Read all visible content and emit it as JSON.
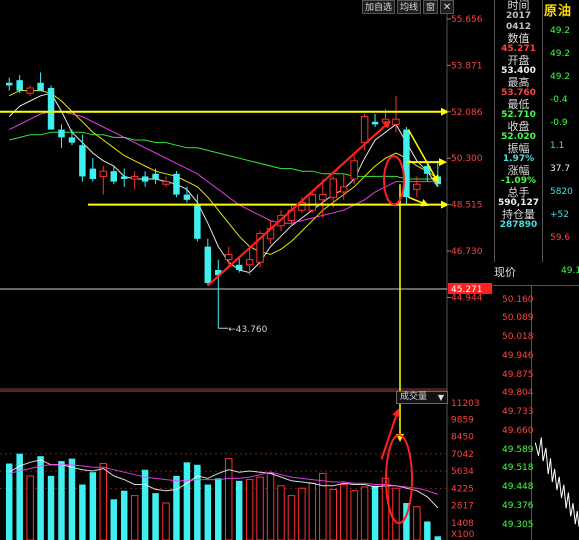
{
  "toolbar": {
    "add_label": "加自选",
    "ma_label": "均线",
    "window_label": "窗",
    "close_label": "✕"
  },
  "price_axis": {
    "ticks": [
      "55.656",
      "53.871",
      "52.086",
      "50.300",
      "48.515",
      "46.730",
      "44.944"
    ],
    "current_marker": "45.271"
  },
  "volume_axis": {
    "menu_label": "成交量",
    "ticks": [
      "11203",
      "9859",
      "8450",
      "7042",
      "5634",
      "4225",
      "2817",
      "1408"
    ],
    "multiplier": "X100"
  },
  "low_annotation": "43.760",
  "info_panel": {
    "time_label": "时间",
    "year": "2017",
    "date": "0412",
    "value_label": "数值",
    "value": "45.271",
    "open_label": "开盘",
    "open": "53.400",
    "high_label": "最高",
    "high": "53.760",
    "low_label": "最低",
    "low": "52.710",
    "close_label": "收盘",
    "close": "52.020",
    "amplitude_label": "振幅",
    "amplitude": "1.97%",
    "change_label": "涨幅",
    "change": "-1.09%",
    "volume_label": "总手",
    "volume": "590,127",
    "oi_label": "持仓量",
    "oi": "287890"
  },
  "side_panel": {
    "title": "原油",
    "rows": [
      {
        "text": "49.2",
        "color": "#40ff40"
      },
      {
        "text": "49.2",
        "color": "#40ff40"
      },
      {
        "text": "49.2",
        "color": "#40ff40"
      },
      {
        "text": "-0.4",
        "color": "#40ff40"
      },
      {
        "text": "-0.9",
        "color": "#40ff40"
      },
      {
        "text": "1.1",
        "color": "#40e0e0"
      },
      {
        "text": "37.7",
        "color": "#f0f0f0"
      },
      {
        "text": "5820",
        "color": "#40e0e0"
      },
      {
        "text": "+52",
        "color": "#40e0e0"
      },
      {
        "text": "59.6",
        "color": "#ff4040"
      }
    ]
  },
  "realtime": {
    "title": "现价",
    "value": "49.1",
    "ticks": [
      "50.160",
      "50.089",
      "50.018",
      "49.946",
      "49.875",
      "49.804",
      "49.733",
      "49.660",
      "49.589",
      "49.518",
      "49.448",
      "49.376",
      "49.305"
    ]
  },
  "colors": {
    "up": "#ff3030",
    "down": "#40f0f0",
    "ma5": "#ffffff",
    "ma10": "#ffff00",
    "ma20": "#ff44ff",
    "ma60": "#40ff40",
    "annotation": "#ffff00",
    "highlight": "#ff2020"
  },
  "chart_data": {
    "type": "candlestick",
    "ylim": [
      43.5,
      56.0
    ],
    "candles": [
      {
        "o": 53.2,
        "h": 53.4,
        "l": 52.9,
        "c": 53.1
      },
      {
        "o": 53.3,
        "h": 53.5,
        "l": 52.8,
        "c": 52.9
      },
      {
        "o": 52.8,
        "h": 53.1,
        "l": 52.7,
        "c": 53.0
      },
      {
        "o": 53.2,
        "h": 53.6,
        "l": 52.9,
        "c": 52.9
      },
      {
        "o": 53.0,
        "h": 53.1,
        "l": 51.4,
        "c": 51.4
      },
      {
        "o": 51.4,
        "h": 51.6,
        "l": 50.7,
        "c": 51.1
      },
      {
        "o": 51.1,
        "h": 51.4,
        "l": 50.8,
        "c": 50.9
      },
      {
        "o": 50.8,
        "h": 51.2,
        "l": 49.4,
        "c": 49.6
      },
      {
        "o": 49.9,
        "h": 50.3,
        "l": 49.4,
        "c": 49.5
      },
      {
        "o": 49.6,
        "h": 50.0,
        "l": 48.9,
        "c": 49.8
      },
      {
        "o": 49.8,
        "h": 50.0,
        "l": 49.3,
        "c": 49.4
      },
      {
        "o": 49.6,
        "h": 49.9,
        "l": 49.2,
        "c": 49.5
      },
      {
        "o": 49.5,
        "h": 49.8,
        "l": 49.1,
        "c": 49.6
      },
      {
        "o": 49.6,
        "h": 49.8,
        "l": 49.2,
        "c": 49.4
      },
      {
        "o": 49.7,
        "h": 49.9,
        "l": 49.3,
        "c": 49.5
      },
      {
        "o": 49.3,
        "h": 49.6,
        "l": 49.2,
        "c": 49.4
      },
      {
        "o": 49.7,
        "h": 49.8,
        "l": 48.8,
        "c": 48.9
      },
      {
        "o": 48.9,
        "h": 49.2,
        "l": 48.6,
        "c": 48.7
      },
      {
        "o": 48.5,
        "h": 48.9,
        "l": 47.1,
        "c": 47.2
      },
      {
        "o": 46.9,
        "h": 47.2,
        "l": 45.4,
        "c": 45.5
      },
      {
        "o": 46.0,
        "h": 46.4,
        "l": 43.76,
        "c": 45.8
      },
      {
        "o": 46.4,
        "h": 46.9,
        "l": 46.2,
        "c": 46.6
      },
      {
        "o": 46.2,
        "h": 46.5,
        "l": 45.9,
        "c": 46.0
      },
      {
        "o": 46.2,
        "h": 46.9,
        "l": 45.8,
        "c": 46.4
      },
      {
        "o": 46.3,
        "h": 47.5,
        "l": 46.1,
        "c": 47.4
      },
      {
        "o": 47.2,
        "h": 47.9,
        "l": 47.0,
        "c": 47.6
      },
      {
        "o": 47.7,
        "h": 48.3,
        "l": 47.5,
        "c": 48.1
      },
      {
        "o": 47.9,
        "h": 48.5,
        "l": 47.7,
        "c": 48.3
      },
      {
        "o": 48.3,
        "h": 48.8,
        "l": 48.2,
        "c": 48.6
      },
      {
        "o": 48.3,
        "h": 49.0,
        "l": 48.2,
        "c": 48.9
      },
      {
        "o": 48.7,
        "h": 49.5,
        "l": 48.0,
        "c": 48.9
      },
      {
        "o": 48.8,
        "h": 49.6,
        "l": 48.4,
        "c": 49.5
      },
      {
        "o": 49.0,
        "h": 49.7,
        "l": 48.7,
        "c": 49.2
      },
      {
        "o": 49.5,
        "h": 50.4,
        "l": 49.3,
        "c": 50.2
      },
      {
        "o": 50.9,
        "h": 52.0,
        "l": 50.6,
        "c": 51.9
      },
      {
        "o": 51.7,
        "h": 52.0,
        "l": 51.5,
        "c": 51.6
      },
      {
        "o": 51.7,
        "h": 52.2,
        "l": 51.5,
        "c": 51.8
      },
      {
        "o": 51.6,
        "h": 52.7,
        "l": 51.3,
        "c": 51.8
      },
      {
        "o": 51.4,
        "h": 51.5,
        "l": 48.5,
        "c": 48.8
      },
      {
        "o": 49.1,
        "h": 49.6,
        "l": 48.8,
        "c": 49.3
      },
      {
        "o": 50.0,
        "h": 50.2,
        "l": 49.4,
        "c": 49.7
      },
      {
        "o": 49.6,
        "h": 50.2,
        "l": 49.2,
        "c": 49.3
      }
    ],
    "volumes": [
      62,
      70,
      52,
      68,
      52,
      64,
      66,
      45,
      55,
      62,
      33,
      40,
      36,
      57,
      38,
      30,
      52,
      63,
      61,
      45,
      50,
      66,
      48,
      49,
      51,
      54,
      44,
      36,
      42,
      46,
      54,
      41,
      45,
      40,
      43,
      44,
      50,
      42,
      30,
      27,
      15,
      3
    ],
    "volume_ylim": [
      0,
      11203
    ],
    "ma_lines": [
      {
        "name": "MA5",
        "color": "#ffffff",
        "points": [
          51.9,
          52.3,
          52.5,
          52.7,
          52.8,
          52.1,
          51.3,
          50.9,
          50.5,
          50.2,
          50.0,
          49.6,
          49.5,
          49.5,
          49.5,
          49.4,
          49.3,
          49.1,
          48.6,
          47.8,
          46.9,
          46.3,
          46.0,
          45.9,
          46.3,
          46.9,
          47.3,
          47.7,
          48.0,
          48.3,
          48.6,
          48.9,
          49.1,
          49.5,
          50.3,
          51.0,
          51.3,
          51.6,
          50.9,
          50.2,
          49.8,
          49.2
        ]
      },
      {
        "name": "MA10",
        "color": "#ffff00",
        "points": [
          52.7,
          52.9,
          52.9,
          52.9,
          52.8,
          52.5,
          52.1,
          51.7,
          51.3,
          51.0,
          50.7,
          50.4,
          50.2,
          50.0,
          49.8,
          49.7,
          49.6,
          49.4,
          49.2,
          48.8,
          48.3,
          47.8,
          47.3,
          46.9,
          46.7,
          46.6,
          46.8,
          47.1,
          47.5,
          47.9,
          48.3,
          48.6,
          48.9,
          49.2,
          49.6,
          50.0,
          50.3,
          50.5,
          50.3,
          50.0,
          49.8,
          49.5
        ]
      },
      {
        "name": "MA20",
        "color": "#ff44ff",
        "points": [
          51.4,
          51.6,
          51.8,
          52.0,
          52.1,
          52.1,
          52.0,
          51.9,
          51.7,
          51.5,
          51.3,
          51.1,
          50.9,
          50.7,
          50.5,
          50.3,
          50.1,
          49.9,
          49.7,
          49.4,
          49.1,
          48.8,
          48.5,
          48.3,
          48.1,
          47.9,
          47.8,
          47.8,
          47.9,
          48.0,
          48.1,
          48.2,
          48.3,
          48.5,
          48.7,
          49.0,
          49.2,
          49.4,
          49.4,
          49.4,
          49.4,
          49.4
        ]
      },
      {
        "name": "MA60",
        "color": "#40ff40",
        "points": [
          51.0,
          51.1,
          51.2,
          51.2,
          51.3,
          51.3,
          51.3,
          51.3,
          51.2,
          51.2,
          51.1,
          51.1,
          51.0,
          51.0,
          50.9,
          50.9,
          50.8,
          50.7,
          50.7,
          50.6,
          50.5,
          50.4,
          50.3,
          50.2,
          50.1,
          50.0,
          49.9,
          49.9,
          49.8,
          49.8,
          49.7,
          49.7,
          49.7,
          49.6,
          49.6,
          49.6,
          49.6,
          49.6,
          49.5,
          49.5,
          49.5,
          49.5
        ]
      }
    ],
    "volume_ma": [
      {
        "name": "VMA5",
        "color": "#ffffff",
        "points": [
          55,
          60,
          63,
          65,
          61,
          61,
          59,
          57,
          56,
          58,
          52,
          49,
          45,
          45,
          41,
          40,
          41,
          46,
          52,
          50,
          54,
          57,
          55,
          56,
          55,
          54,
          51,
          48,
          47,
          46,
          44,
          44,
          46,
          45,
          45,
          43,
          44,
          44,
          42,
          40,
          35,
          26
        ]
      },
      {
        "name": "VMA10",
        "color": "#ff44ff",
        "points": [
          54,
          56,
          58,
          60,
          61,
          61,
          61,
          60,
          59,
          59,
          57,
          55,
          53,
          51,
          50,
          49,
          48,
          48,
          49,
          49,
          49,
          50,
          50,
          51,
          53,
          55,
          53,
          51,
          50,
          49,
          48,
          47,
          47,
          46,
          46,
          45,
          45,
          44,
          43,
          42,
          40,
          37
        ]
      }
    ],
    "volume_gridlines": [
      7042,
      5634,
      4225
    ],
    "horizontal_levels": [
      52.086,
      48.515
    ],
    "current_price_line": 45.271
  },
  "realtime_chart": {
    "ylim": [
      49.25,
      50.2
    ],
    "points": [
      [
        0.05,
        49.62
      ],
      [
        0.12,
        49.57
      ],
      [
        0.18,
        49.64
      ],
      [
        0.22,
        49.55
      ],
      [
        0.28,
        49.6
      ],
      [
        0.33,
        49.5
      ],
      [
        0.38,
        49.56
      ],
      [
        0.42,
        49.47
      ],
      [
        0.47,
        49.52
      ],
      [
        0.52,
        49.44
      ],
      [
        0.57,
        49.49
      ],
      [
        0.62,
        49.41
      ],
      [
        0.67,
        49.46
      ],
      [
        0.72,
        49.37
      ],
      [
        0.77,
        49.43
      ],
      [
        0.82,
        49.34
      ],
      [
        0.87,
        49.39
      ],
      [
        0.92,
        49.31
      ],
      [
        0.96,
        49.36
      ],
      [
        1.0,
        49.3
      ]
    ]
  }
}
